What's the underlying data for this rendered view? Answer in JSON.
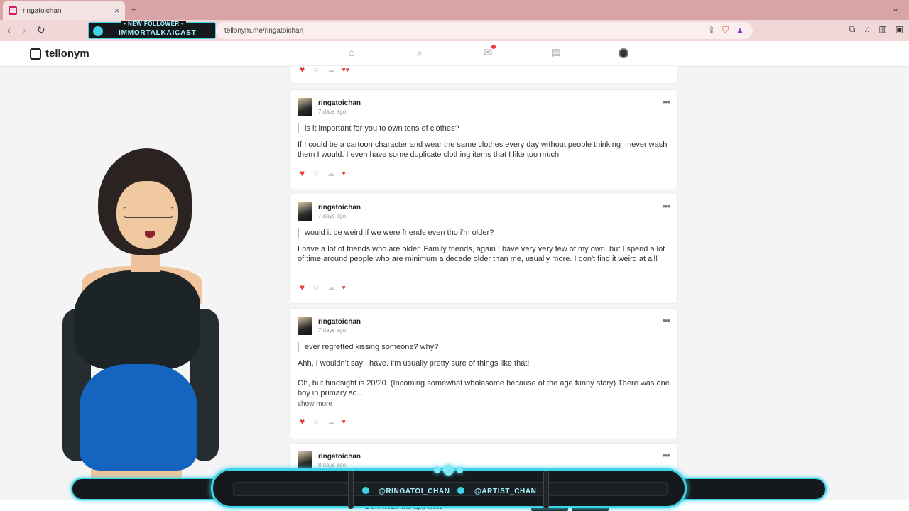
{
  "browser": {
    "tab_title": "ringatoichan",
    "tab_close": "×",
    "new_tab": "+",
    "url": "tellonym.me/ringatoichan",
    "back": "‹",
    "forward": "›",
    "reload": "↻"
  },
  "overlay": {
    "new_follower_label": "• NEW FOLLOWER •",
    "follower_name": "IMMORTALKAICAST",
    "twitter_handle": "@RINGATOI_CHAN",
    "artist_handle": "@ARTIST_CHAN"
  },
  "site": {
    "logo_text": "tellonym",
    "nav_icons": [
      "home-icon",
      "search-icon",
      "inbox-icon",
      "chat-icon",
      "profile-avatar"
    ]
  },
  "posts": [
    {
      "username": "ringatoichan",
      "time": "7 days ago",
      "question": "is it important for you to own tons of clothes?",
      "answer": "If I could be a cartoon character and wear the same clothes every day without people thinking I never wash them I would. I even have some duplicate clothing items that I like too much"
    },
    {
      "username": "ringatoichan",
      "time": "7 days ago",
      "question": "would it be weird if we were friends even tho i'm older?",
      "answer": "I have a lot of friends who are older. Family friends, again I have very very few of my own, but I spend a lot of time around people who are minimum a decade older than me, usually more. I don't find it weird at all!"
    },
    {
      "username": "ringatoichan",
      "time": "7 days ago",
      "question": "ever regretted kissing someone? why?",
      "answer_p1": "Ahh, I wouldn't say I have. I'm usually pretty sure of things like that!",
      "answer_p2": "Oh, but hindsight is 20/20. (Incoming somewhat wholesome because of the age funny story) There was one boy in primary sc...",
      "show_more": "show more"
    },
    {
      "username": "ringatoichan",
      "time": "8 days ago"
    }
  ],
  "bottom_banner": "Download the app now",
  "colors": {
    "accent_cyan": "#3fd3e8",
    "heart": "#e53935",
    "tab_bar": "#d9a4a6"
  }
}
